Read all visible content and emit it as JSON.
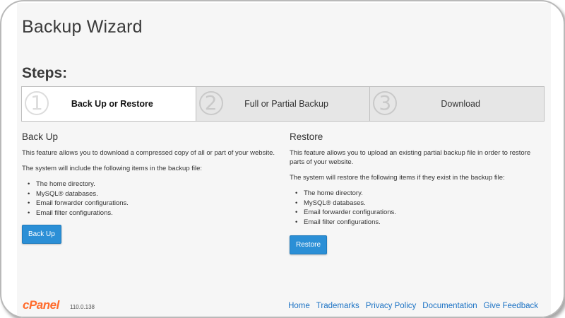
{
  "header": {
    "title": "Backup Wizard",
    "steps_label": "Steps:"
  },
  "steps": [
    {
      "number": "1",
      "label": "Back Up or Restore",
      "active": true
    },
    {
      "number": "2",
      "label": "Full or Partial Backup",
      "active": false
    },
    {
      "number": "3",
      "label": "Download",
      "active": false
    }
  ],
  "backup": {
    "heading": "Back Up",
    "description": "This feature allows you to download a compressed copy of all or part of your website.",
    "includes_text": "The system will include the following items in the backup file:",
    "items": [
      "The home directory.",
      "MySQL® databases.",
      "Email forwarder configurations.",
      "Email filter configurations."
    ],
    "button_label": "Back Up"
  },
  "restore": {
    "heading": "Restore",
    "description": "This feature allows you to upload an existing partial backup file in order to restore parts of your website.",
    "includes_text": "The system will restore the following items if they exist in the backup file:",
    "items": [
      "The home directory.",
      "MySQL® databases.",
      "Email forwarder configurations.",
      "Email filter configurations."
    ],
    "button_label": "Restore"
  },
  "footer": {
    "logo_text": "cPanel",
    "version": "110.0.138",
    "links": [
      "Home",
      "Trademarks",
      "Privacy Policy",
      "Documentation",
      "Give Feedback"
    ]
  },
  "colors": {
    "accent": "#2b8fd6",
    "link": "#1b72c4",
    "brand": "#ff6c2c",
    "background": "#f6f6f6"
  }
}
